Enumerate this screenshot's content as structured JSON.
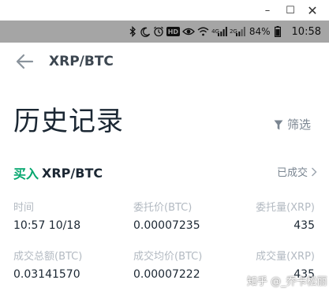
{
  "window": {
    "minimize_glyph": "–",
    "maximize_glyph": "☐",
    "close_glyph": "✕"
  },
  "status_bar": {
    "icons": [
      "bluetooth-icon",
      "moon-icon",
      "alarm-icon",
      "hd-icon",
      "eye-icon",
      "wifi-icon",
      "signal-4g-icon",
      "signal-2g-icon",
      "battery-icon"
    ],
    "hd_text": "HD",
    "net1": "4G",
    "net2": "2G",
    "battery": "84%",
    "time": "10:58"
  },
  "header": {
    "title": "XRP/BTC"
  },
  "page": {
    "title": "历史记录",
    "filter_label": "筛选"
  },
  "order": {
    "side": "买入",
    "pair": "XRP/BTC",
    "status": "已成交",
    "labels_row1": [
      "时间",
      "委托价(BTC)",
      "委托量(XRP)"
    ],
    "values_row1": [
      "10:57 10/18",
      "0.00007235",
      "435"
    ],
    "labels_row2": [
      "成交总额(BTC)",
      "成交均价(BTC)",
      "成交量(XRP)"
    ],
    "values_row2": [
      "0.03141570",
      "0.00007222",
      "435"
    ]
  },
  "watermark": "知乎 @_乔卡松丽"
}
